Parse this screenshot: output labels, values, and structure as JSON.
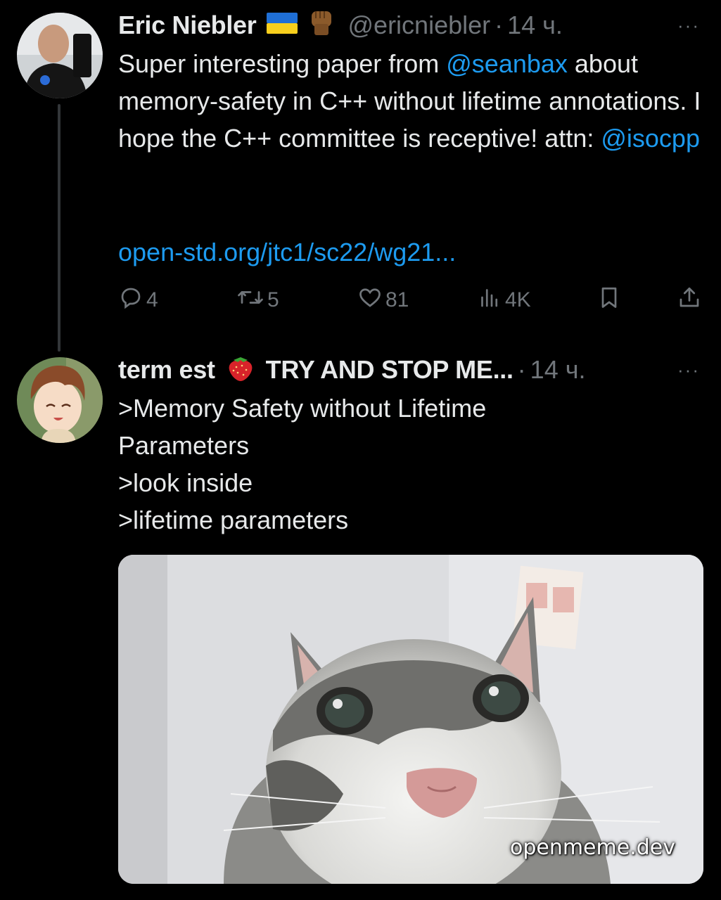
{
  "tweet1": {
    "author_name": "Eric Niebler",
    "flag_emoji": "flag-ukraine-icon",
    "fist_emoji": "raised-fist-icon",
    "handle": "@ericniebler",
    "separator": "·",
    "time": "14 ч.",
    "more": "···",
    "text_before": "Super interesting paper from ",
    "mention1": "@seanbax",
    "text_middle": " about memory-safety in C++ without lifetime annotations. I hope the C++ committee is receptive! attn: ",
    "mention2": "@isocpp",
    "url": "open-std.org/jtc1/sc22/wg21...",
    "replies": "4",
    "reposts": "5",
    "likes": "81",
    "views": "4K"
  },
  "tweet2": {
    "author_name": "term est",
    "emoji": "strawberry-icon",
    "author_name_suffix": "TRY AND STOP ME...",
    "separator": "·",
    "time": "14 ч.",
    "more": "···",
    "lines": [
      ">Memory Safety without Lifetime",
      "Parameters",
      ">look inside",
      ">lifetime parameters"
    ],
    "media_alt": "close-up cat photo",
    "watermark": "openmeme.dev"
  },
  "colors": {
    "background": "#000000",
    "text": "#e7e9ea",
    "muted": "#71767b",
    "link": "#1d9bf0",
    "thread_line": "#333639"
  }
}
